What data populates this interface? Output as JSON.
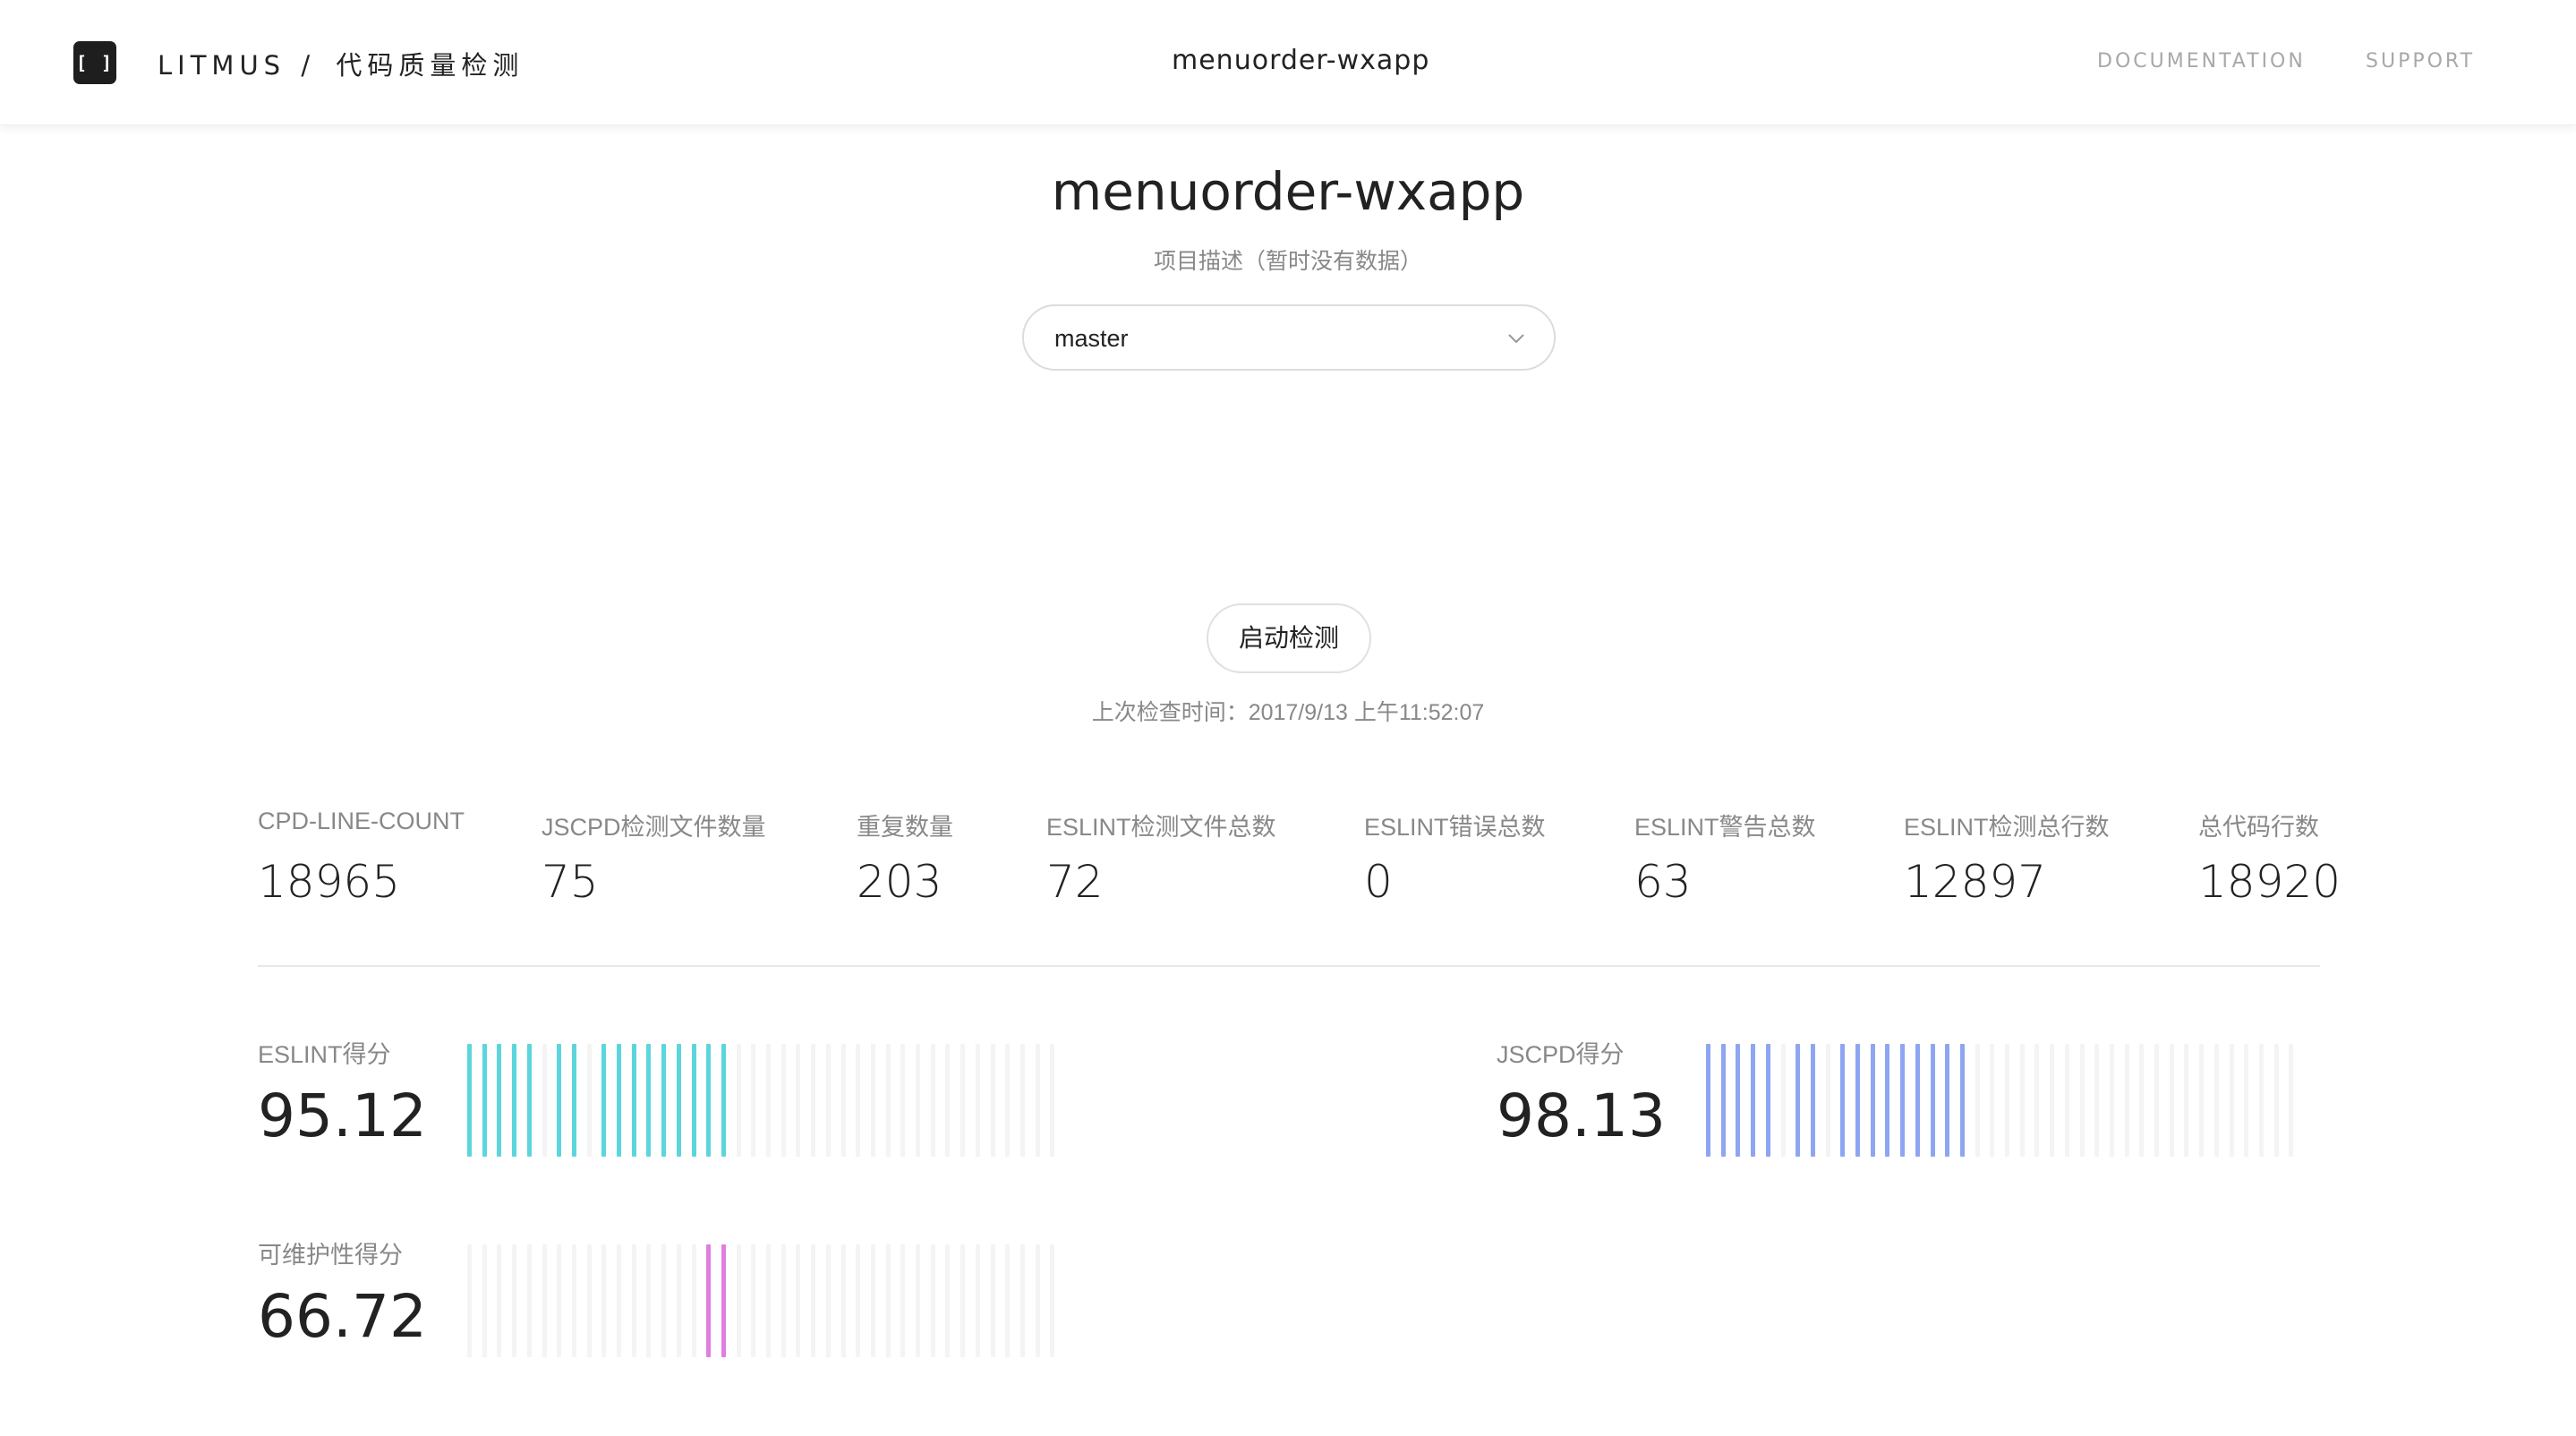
{
  "header": {
    "logo_text": "[ ]",
    "brand": "LITMUS",
    "brand_sep": "/",
    "brand_sub": "代码质量检测",
    "title": "menuorder-wxapp",
    "nav": {
      "documentation": "DOCUMENTATION",
      "support": "SUPPORT"
    }
  },
  "project": {
    "name": "menuorder-wxapp",
    "description": "项目描述（暂时没有数据）",
    "branch": "master",
    "run_label": "启动检测",
    "last_check": "上次检查时间：2017/9/13 上午11:52:07"
  },
  "stats": [
    {
      "label": "CPD-LINE-COUNT",
      "value": "18965"
    },
    {
      "label": "JSCPD检测文件数量",
      "value": "75"
    },
    {
      "label": "重复数量",
      "value": "203"
    },
    {
      "label": "ESLINT检测文件总数",
      "value": "72"
    },
    {
      "label": "ESLINT错误总数",
      "value": "0"
    },
    {
      "label": "ESLINT警告总数",
      "value": "63"
    },
    {
      "label": "ESLINT检测总行数",
      "value": "12897"
    },
    {
      "label": "总代码行数",
      "value": "18920"
    }
  ],
  "scores": [
    {
      "label": "ESLINT得分",
      "value": "95.12",
      "score": 95.12,
      "color": "#5cd6dc",
      "active_bars": [
        0,
        1,
        2,
        3,
        4,
        6,
        7,
        9,
        10,
        11,
        12,
        13,
        14,
        15,
        16,
        17
      ]
    },
    {
      "label": "JSCPD得分",
      "value": "98.13",
      "score": 98.13,
      "color": "#8ea5f2",
      "active_bars": [
        0,
        1,
        2,
        3,
        4,
        6,
        7,
        9,
        10,
        11,
        12,
        13,
        14,
        15,
        16,
        17
      ]
    },
    {
      "label": "可维护性得分",
      "value": "66.72",
      "score": 66.72,
      "color": "#e07ee0",
      "active_bars": [
        16,
        17
      ]
    }
  ],
  "colors": {
    "inactive_bar": "#f4f4f4",
    "divider": "#e8e8e8",
    "accent_dark": "#1e1e1e"
  },
  "icons": {
    "logo": "brackets-logo-icon",
    "dropdown": "chevron-down-icon"
  }
}
